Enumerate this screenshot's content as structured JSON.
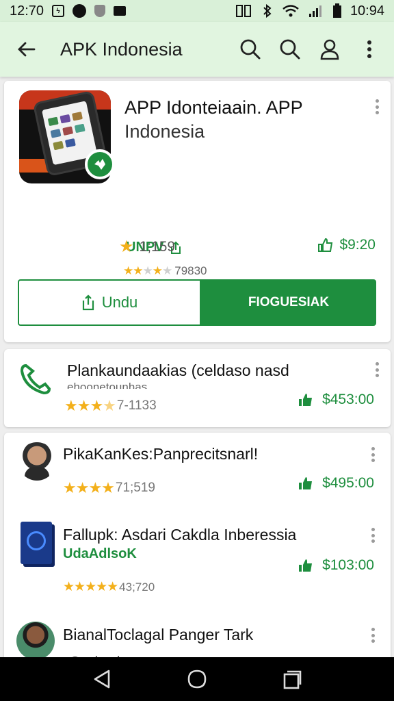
{
  "status_bar": {
    "time": "12:70",
    "clock": "10:94"
  },
  "app_bar": {
    "title": "APK Indonesia"
  },
  "featured": {
    "title": "APP Idonteiaain. APP",
    "subtitle": "Indonesia",
    "developer": "UNPV",
    "rating_count": "79830",
    "stat_left": "1;159",
    "stat_right": "$9:20",
    "button_outline": "Undu",
    "button_fill": "FIOGUESIAK"
  },
  "items": [
    {
      "title": "Plankaundaakias (celdaso nasd",
      "subtitle": "ehoonetounhas",
      "rating": "7-1133",
      "price": "$453:00"
    },
    {
      "title": "PikaKanKes:Panprecitsnarl!",
      "rating": "71;519",
      "price": "$495:00"
    },
    {
      "title": "Fallupk: Asdari Cakdla Inberessia",
      "developer": "UdaAdlsoK",
      "rating": "43;720",
      "price": "$103:00"
    },
    {
      "title": "BianalToclagal Panger Tark",
      "subtitle": "Ouskoehounn"
    }
  ],
  "colors": {
    "accent": "#1e8e3e",
    "app_bar": "#e1f5e0",
    "star": "#f3b01b"
  }
}
